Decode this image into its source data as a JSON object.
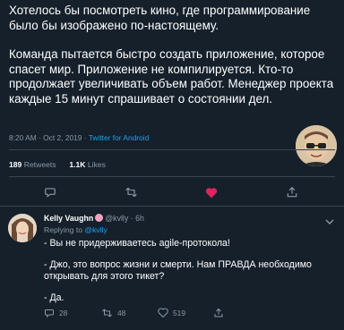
{
  "tweet": {
    "paragraphs": [
      "Хотелось бы посмотреть кино, где программирование было бы изображено по-настоящему.",
      "Команда пытается быстро создать приложение, которое спасет мир. Приложение не компилируется. Кто-то продолжает увеличивать объем работ. Менеджер проекта каждые 15 минут спрашивает о состоянии дел."
    ],
    "timestamp": "8:20 AM · Oct 2, 2019 · ",
    "source": "Twitter for Android",
    "retweets_count": "189",
    "retweets_label": "Retweets",
    "likes_count": "1.1K",
    "likes_label": "Likes"
  },
  "reply": {
    "name": "Kelly Vaughn",
    "handle": "@kvlly · 6h",
    "replying_prefix": "Replying to ",
    "replying_handle": "@kvlly",
    "paragraphs": [
      "- Вы не придерживаетесь agile-протокола!",
      "- Джо, это вопрос жизни и смерти. Нам ПРАВДА необходимо открывать для этого тикет?",
      "- Да."
    ],
    "reply_count": "28",
    "retweet_count": "48",
    "like_count": "519"
  },
  "icons": [
    "reply-icon",
    "retweet-icon",
    "heart-icon",
    "share-icon",
    "chevron-down-icon"
  ],
  "colors": {
    "background": "#15202b",
    "text": "#ffffff",
    "muted": "#8899a6",
    "accent": "#1da1f2",
    "like": "#e0245e",
    "divider": "#38444d"
  }
}
